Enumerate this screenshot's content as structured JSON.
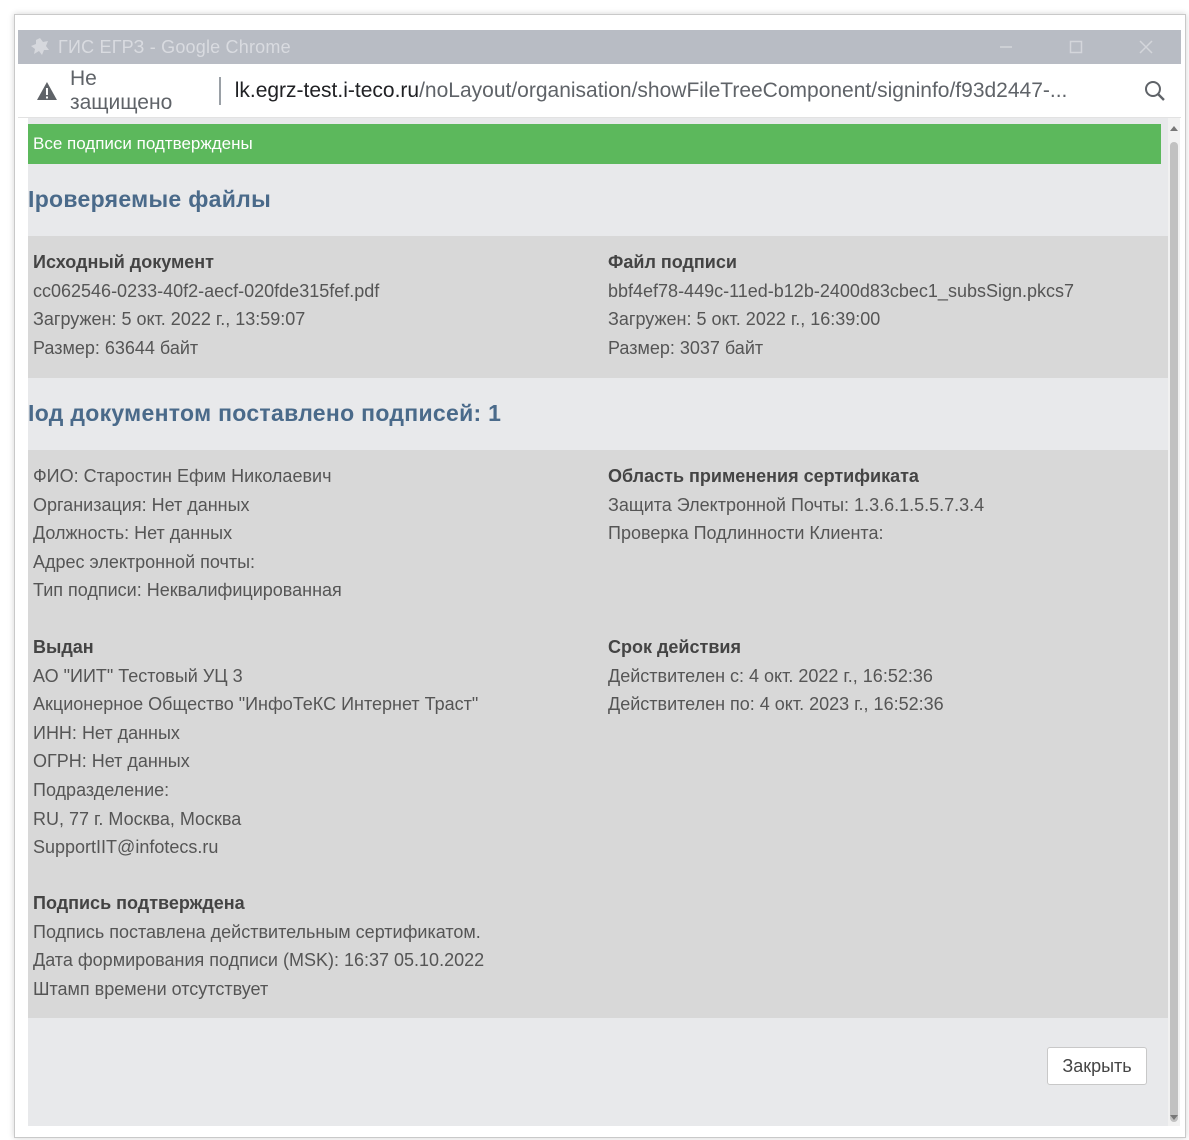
{
  "window": {
    "title": "ГИС ЕГРЗ - Google Chrome"
  },
  "addressbar": {
    "insecure_label": "Не защищено",
    "url_host": "lk.egrz-test.i-teco.ru",
    "url_path": "/noLayout/organisation/showFileTreeComponent/signinfo/f93d2447-..."
  },
  "banner": {
    "text": "Все подписи подтверждены",
    "color": "#5cb85c"
  },
  "files_section": {
    "title": "Іроверяемые файлы",
    "source": {
      "heading": "Исходный документ",
      "filename": "cc062546-0233-40f2-aecf-020fde315fef.pdf",
      "uploaded": "Загружен: 5 окт. 2022 г., 13:59:07",
      "size": "Размер: 63644 байт"
    },
    "signature": {
      "heading": "Файл подписи",
      "filename": "bbf4ef78-449c-11ed-b12b-2400d83cbec1_subsSign.pkcs7",
      "uploaded": "Загружен: 5 окт. 2022 г., 16:39:00",
      "size": "Размер: 3037 байт"
    }
  },
  "signatures_section": {
    "title": "Іод документом поставлено подписей: 1",
    "signer": {
      "fio": "ФИО: Старостин Ефим Николаевич",
      "organization": "Организация: Нет данных",
      "position": "Должность: Нет данных",
      "email": "Адрес электронной почты:",
      "sign_type": "Тип подписи: Неквалифицированная"
    },
    "cert_scope": {
      "heading": "Область применения сертификата",
      "email_protection": "Защита Электронной Почты: 1.3.6.1.5.5.7.3.4",
      "client_auth": "Проверка Подлинности Клиента:"
    },
    "issuer": {
      "heading": "Выдан",
      "line1": "АО \"ИИТ\" Тестовый УЦ 3",
      "line2": "Акционерное Общество \"ИнфоТеКС Интернет Траст\"",
      "inn": "ИНН: Нет данных",
      "ogrn": "ОГРН: Нет данных",
      "division": "Подразделение:",
      "location": "RU, 77 г. Москва, Москва",
      "email": "SupportIIT@infotecs.ru"
    },
    "validity": {
      "heading": "Срок действия",
      "from": "Действителен с: 4 окт. 2022 г., 16:52:36",
      "to": "Действителен по: 4 окт. 2023 г., 16:52:36"
    },
    "verification": {
      "heading": "Подпись подтверждена",
      "line1": "Подпись поставлена действительным сертификатом.",
      "line2": "Дата формирования подписи (MSK): 16:37 05.10.2022",
      "line3": "Штамп времени отсутствует"
    }
  },
  "footer": {
    "close_label": "Закрыть"
  }
}
